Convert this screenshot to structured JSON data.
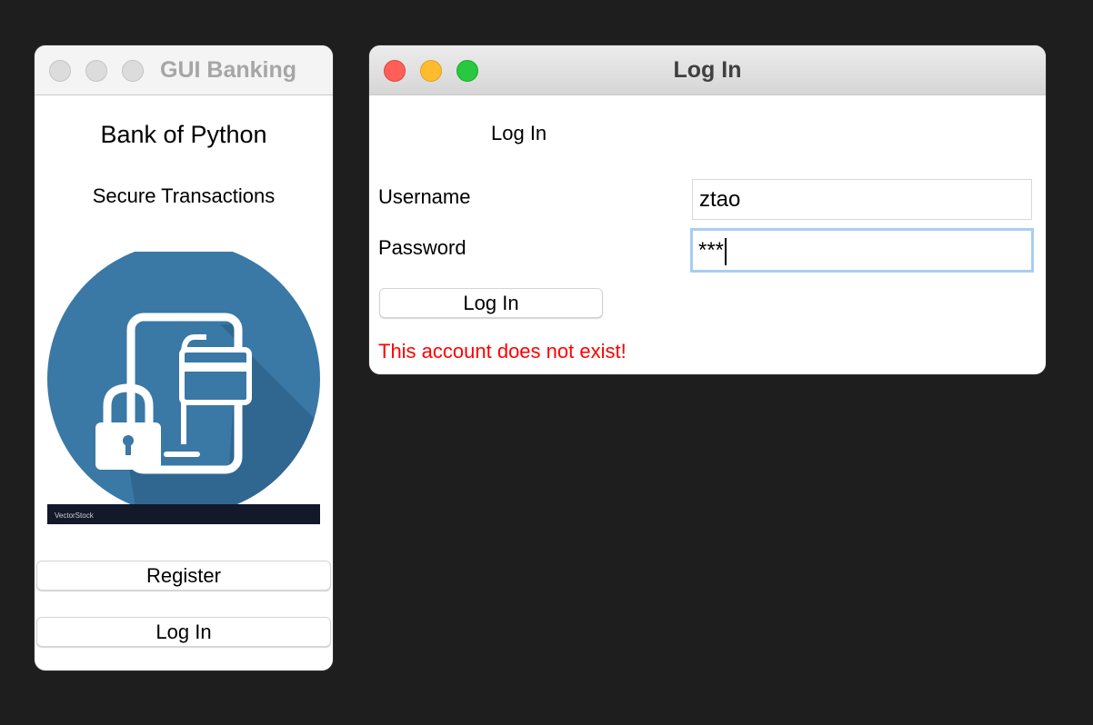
{
  "main_window": {
    "title": "GUI Banking",
    "heading": "Bank of Python",
    "subheading": "Secure Transactions",
    "image_watermark": "VectorStock",
    "buttons": {
      "register": "Register",
      "log_in": "Log In"
    }
  },
  "login_window": {
    "title": "Log In",
    "heading": "Log In",
    "username_label": "Username",
    "username_value": "ztao",
    "password_label": "Password",
    "password_value": "***",
    "submit_label": "Log In",
    "error_message": "This account does not exist!"
  },
  "colors": {
    "desktop_background": "#1e1e1e",
    "traffic_close": "#ff5f57",
    "traffic_minimize": "#febc2e",
    "traffic_zoom": "#28c840",
    "error_text": "#ff0000",
    "focus_ring": "#a9cdf2",
    "illustration_circle": "#3a78a6"
  },
  "icons": [
    "tablet-padlock-card-illustration",
    "padlock-icon",
    "credit-card-icon"
  ]
}
